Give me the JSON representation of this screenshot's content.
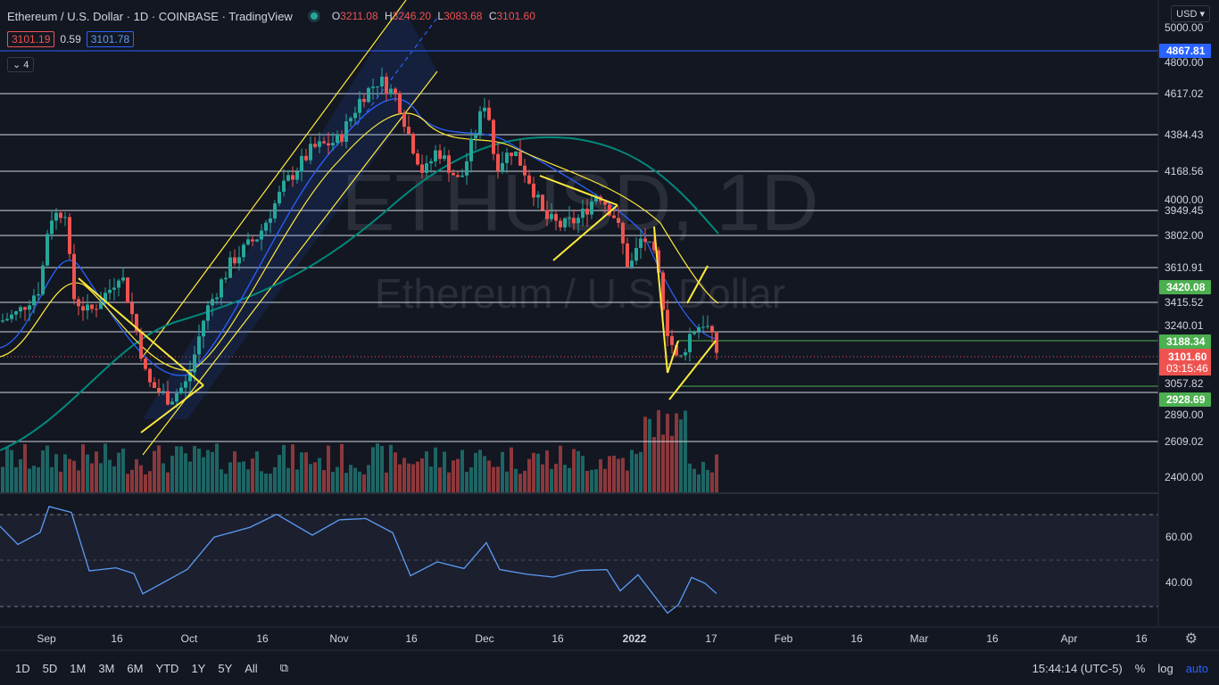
{
  "header": {
    "title": "Ethereum / U.S. Dollar · 1D · COINBASE · TradingView",
    "ohlc": [
      {
        "label": "O",
        "value": "3211.08"
      },
      {
        "label": "H",
        "value": "3246.20"
      },
      {
        "label": "L",
        "value": "3083.68"
      },
      {
        "label": "C",
        "value": "3101.60"
      }
    ],
    "bid": "3101.19",
    "spread": "0.59",
    "ask": "3101.78",
    "indicators_toggle": "4"
  },
  "watermark": {
    "symbol": "ETHUSD, 1D",
    "name": "Ethereum / U.S. Dollar"
  },
  "currency": "USD",
  "price_labels": [
    "5000.00",
    "4800.00",
    "4617.02",
    "4384.43",
    "4168.56",
    "4000.00",
    "3949.45",
    "3802.00",
    "3610.91",
    "3415.52",
    "3240.01",
    "3057.82",
    "2890.00",
    "2609.02",
    "2400.00"
  ],
  "price_badges": {
    "ath": "4867.81",
    "green_upper": "3420.08",
    "green_mid": "3188.34",
    "green_lower": "2928.69",
    "last_price": "3101.60",
    "countdown": "03:15:46"
  },
  "rsi_labels": [
    "60.00",
    "40.00"
  ],
  "time_labels": [
    "Sep",
    "16",
    "Oct",
    "16",
    "Nov",
    "16",
    "Dec",
    "16",
    "2022",
    "17",
    "Feb",
    "16",
    "Mar",
    "16",
    "Apr",
    "16"
  ],
  "timeframes": [
    "1D",
    "5D",
    "1M",
    "3M",
    "6M",
    "YTD",
    "1Y",
    "5Y",
    "All"
  ],
  "bottom_right": {
    "clock": "15:44:14 (UTC-5)",
    "percent": "%",
    "log": "log",
    "auto": "auto"
  },
  "colors": {
    "up": "#26a69a",
    "down": "#ef5350",
    "trend": "#ffeb3b",
    "ema": "#2962ff",
    "sma": "#00897b",
    "bg": "#131722"
  },
  "chart_data": {
    "type": "candlestick",
    "x": [
      "Sep",
      "16",
      "Oct",
      "16",
      "Nov",
      "16",
      "Dec",
      "16",
      "2022",
      "17"
    ],
    "ylim": [
      2400,
      5000
    ],
    "rsi_range": [
      30,
      70
    ],
    "horizontal_levels": [
      4617.02,
      4384.43,
      4168.56,
      3949.45,
      3802.0,
      3610.91,
      3415.52,
      3240.01,
      3057.82,
      2890.0,
      2609.02
    ]
  }
}
